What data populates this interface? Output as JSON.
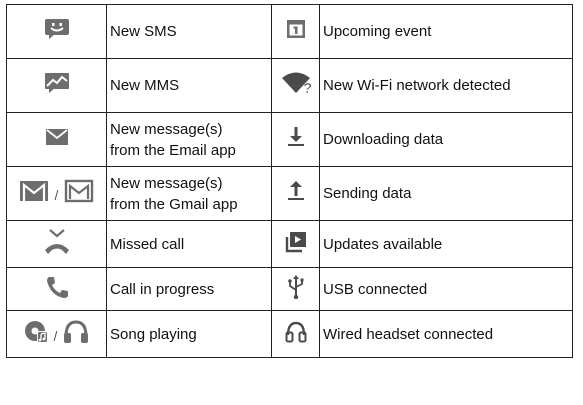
{
  "colors": {
    "icon_gray": "#6d6d6d",
    "icon_dark": "#4a4a4a",
    "border": "#222222",
    "text": "#111111"
  },
  "rows": [
    {
      "left": {
        "icons": [
          "sms-smiley-icon"
        ],
        "label": "New SMS"
      },
      "right": {
        "icons": [
          "calendar-icon"
        ],
        "label": "Upcoming event"
      }
    },
    {
      "left": {
        "icons": [
          "mms-picture-icon"
        ],
        "label": "New MMS"
      },
      "right": {
        "icons": [
          "wifi-question-icon"
        ],
        "label": "New Wi-Fi network detected"
      }
    },
    {
      "left": {
        "icons": [
          "email-envelope-icon"
        ],
        "label": "New message(s)\nfrom the Email app"
      },
      "right": {
        "icons": [
          "download-arrow-icon"
        ],
        "label": "Downloading data"
      }
    },
    {
      "left": {
        "icons": [
          "gmail-icon",
          "gmail-outline-icon"
        ],
        "separator": "/",
        "label": "New message(s)\nfrom the Gmail app"
      },
      "right": {
        "icons": [
          "upload-arrow-icon"
        ],
        "label": "Sending data"
      }
    },
    {
      "left": {
        "icons": [
          "missed-call-icon"
        ],
        "label": "Missed call"
      },
      "right": {
        "icons": [
          "updates-available-icon"
        ],
        "label": "Updates available"
      }
    },
    {
      "left": {
        "icons": [
          "call-in-progress-icon"
        ],
        "label": "Call in progress"
      },
      "right": {
        "icons": [
          "usb-icon"
        ],
        "label": "USB connected"
      }
    },
    {
      "left": {
        "icons": [
          "music-note-icon",
          "headphones-icon"
        ],
        "separator": "/",
        "label": "Song playing"
      },
      "right": {
        "icons": [
          "wired-headset-icon"
        ],
        "label": "Wired headset connected"
      }
    }
  ]
}
